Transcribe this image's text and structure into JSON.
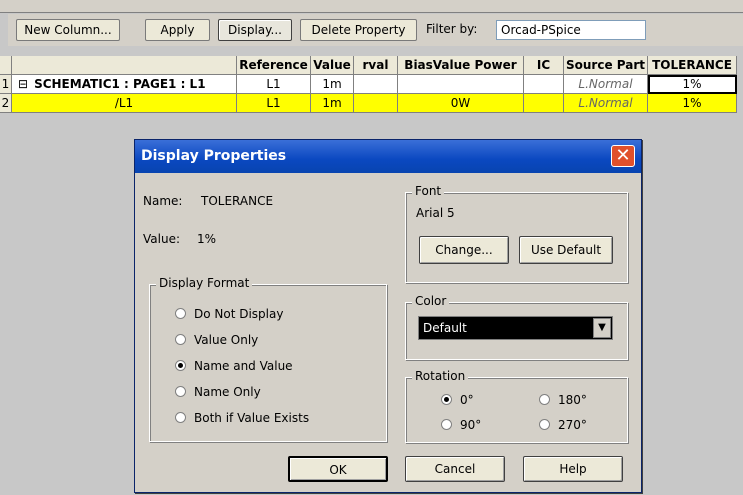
{
  "toolbar": {
    "new_column": "New Column...",
    "apply": "Apply",
    "display": "Display...",
    "delete_property": "Delete Property",
    "filter_label": "Filter by:",
    "filter_value": "Orcad-PSpice"
  },
  "grid": {
    "headers": [
      "Reference",
      "Value",
      "rval",
      "BiasValue Power",
      "IC",
      "Source Part",
      "TOLERANCE"
    ],
    "rows": [
      {
        "num": "1",
        "name": "SCHEMATIC1 : PAGE1 : L1",
        "expander": "⊟",
        "reference": "L1",
        "value": "1m",
        "rval": "",
        "bias": "",
        "ic": "",
        "source": "L.Normal",
        "tolerance": "1%"
      },
      {
        "num": "2",
        "name": "/L1",
        "reference": "L1",
        "value": "1m",
        "rval": "",
        "bias": "0W",
        "ic": "",
        "source": "L.Normal",
        "tolerance": "1%"
      }
    ]
  },
  "dialog": {
    "title": "Display Properties",
    "name_label": "Name:",
    "name_value": "TOLERANCE",
    "value_label": "Value:",
    "value_value": "1%",
    "display_format": {
      "title": "Display Format",
      "options": [
        "Do Not Display",
        "Value Only",
        "Name and Value",
        "Name Only",
        "Both if Value Exists"
      ],
      "selected": "Name and Value"
    },
    "font": {
      "title": "Font",
      "current": "Arial 5",
      "change": "Change...",
      "use_default": "Use Default"
    },
    "color": {
      "title": "Color",
      "selected": "Default"
    },
    "rotation": {
      "title": "Rotation",
      "options": [
        "0°",
        "90°",
        "180°",
        "270°"
      ],
      "selected": "0°"
    },
    "ok": "OK",
    "cancel": "Cancel",
    "help": "Help"
  },
  "colors": {
    "row_highlight": "#ffff00",
    "title_bar": "#0a48c0",
    "close_button": "#e0502c"
  }
}
